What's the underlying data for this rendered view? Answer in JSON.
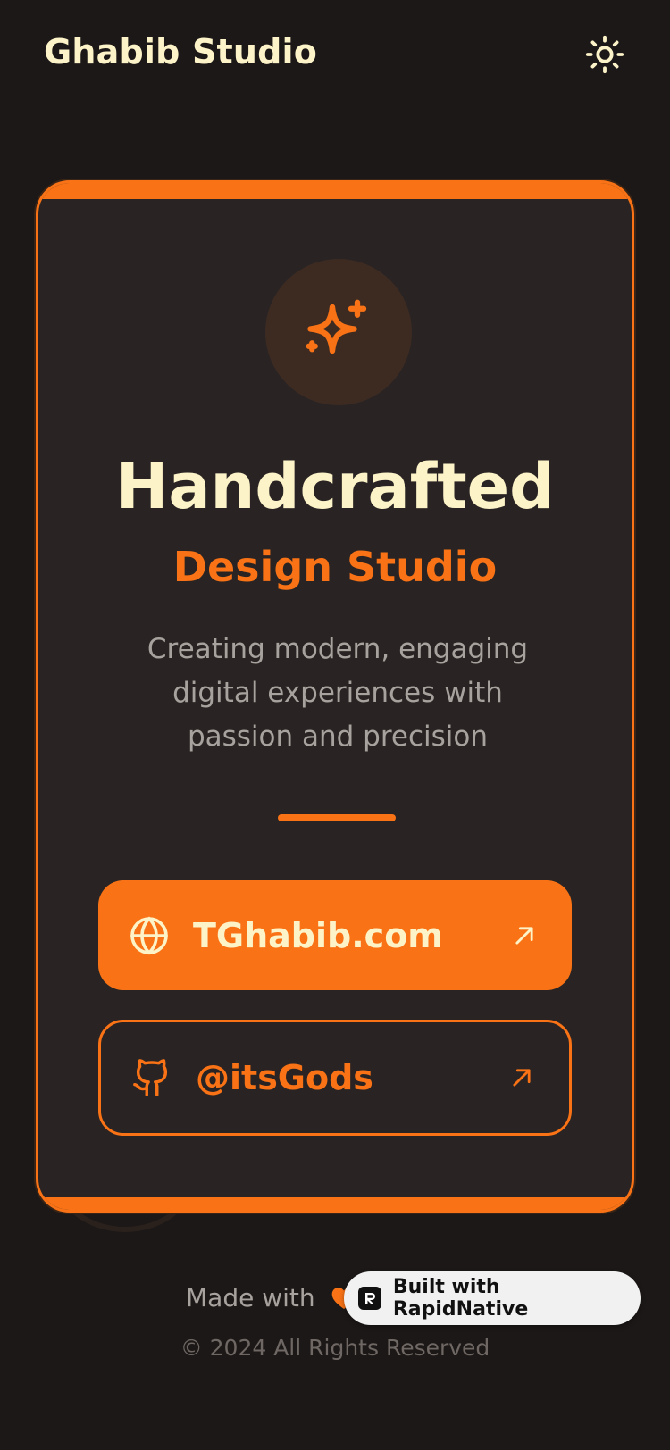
{
  "header": {
    "brand": "Ghabib Studio",
    "theme_icon": "sun-icon"
  },
  "hero": {
    "icon": "sparkles-icon",
    "title": "Handcrafted",
    "subtitle": "Design Studio",
    "description": "Creating modern, engaging digital experiences with passion and precision"
  },
  "links": [
    {
      "label": "TGhabib.com",
      "icon": "globe-icon",
      "arrow_icon": "arrow-up-right-icon"
    },
    {
      "label": "@itsGods",
      "icon": "github-icon",
      "arrow_icon": "arrow-up-right-icon"
    }
  ],
  "footer": {
    "made_with": "Made with",
    "heart_icon": "heart-icon",
    "copyright": "© 2024 All Rights Reserved"
  },
  "badge": {
    "label": "Built with RapidNative",
    "logo_icon": "rapidnative-logo-icon"
  },
  "colors": {
    "background": "#1c1817",
    "card": "#292423",
    "accent": "#f97316",
    "cream": "#fdf3c8",
    "muted": "#a8a29e"
  }
}
